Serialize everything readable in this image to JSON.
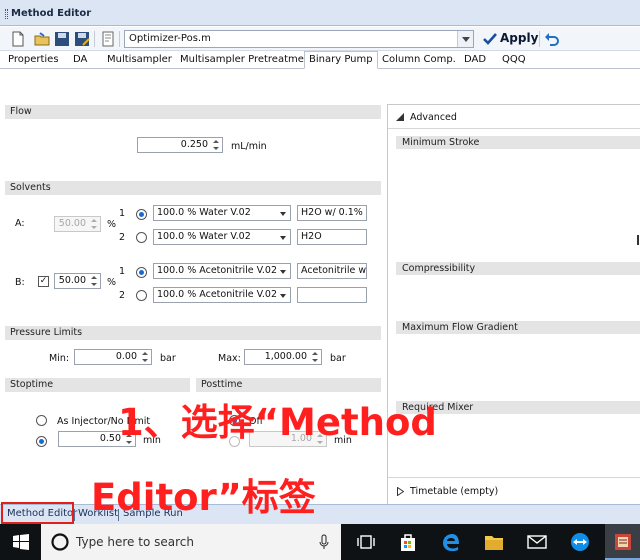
{
  "window": {
    "title": "Method Editor"
  },
  "toolbar": {
    "method_value": "Optimizer-Pos.m",
    "apply_label": "Apply"
  },
  "tabs": [
    {
      "label": "Properties"
    },
    {
      "label": "DA"
    },
    {
      "label": "Multisampler"
    },
    {
      "label": "Multisampler Pretreatment"
    },
    {
      "label": "Binary Pump"
    },
    {
      "label": "Column Comp."
    },
    {
      "label": "DAD"
    },
    {
      "label": "QQQ"
    }
  ],
  "flow": {
    "header": "Flow",
    "value": "0.250",
    "unit": "mL/min"
  },
  "solvents": {
    "header": "Solvents",
    "a": {
      "label": "A:",
      "percent": "50.00",
      "percent_unit": "%",
      "ch1_num": "1",
      "ch1_select": "100.0 % Water V.02",
      "ch1_name": "H2O w/ 0.1%",
      "ch2_num": "2",
      "ch2_select": "100.0 % Water V.02",
      "ch2_name": "H2O"
    },
    "b": {
      "label": "B:",
      "checked_mark": "✓",
      "percent": "50.00",
      "percent_unit": "%",
      "ch1_num": "1",
      "ch1_select": "100.0 % Acetonitrile V.02",
      "ch1_name": "Acetonitrile w/",
      "ch2_num": "2",
      "ch2_select": "100.0 % Acetonitrile V.02",
      "ch2_name": ""
    }
  },
  "pressure": {
    "header": "Pressure Limits",
    "min_label": "Min:",
    "min_value": "0.00",
    "min_unit": "bar",
    "max_label": "Max:",
    "max_value": "1,000.00",
    "max_unit": "bar"
  },
  "stoptime": {
    "header": "Stoptime",
    "opt1": "As Injector/No Limit",
    "value": "0.50",
    "unit": "min"
  },
  "posttime": {
    "header": "Posttime",
    "opt1": "Off",
    "value": "1.00",
    "unit": "min"
  },
  "advanced": {
    "header": "Advanced",
    "sections": [
      "Minimum Stroke",
      "Compressibility",
      "Maximum Flow Gradient",
      "Required Mixer"
    ],
    "timetable": "Timetable (empty)"
  },
  "bottom_tabs": [
    {
      "label": "Method Editor"
    },
    {
      "label": "Worklist"
    },
    {
      "label": "Sample Run"
    }
  ],
  "taskbar": {
    "search_placeholder": "Type here to search"
  },
  "annotation": {
    "line1": "1、选择“Method",
    "line2": "Editor”标签"
  },
  "colors": {
    "accent": "#1a6ad6",
    "annotation": "#ff1f1f",
    "highlight_box": "#e0201a"
  }
}
